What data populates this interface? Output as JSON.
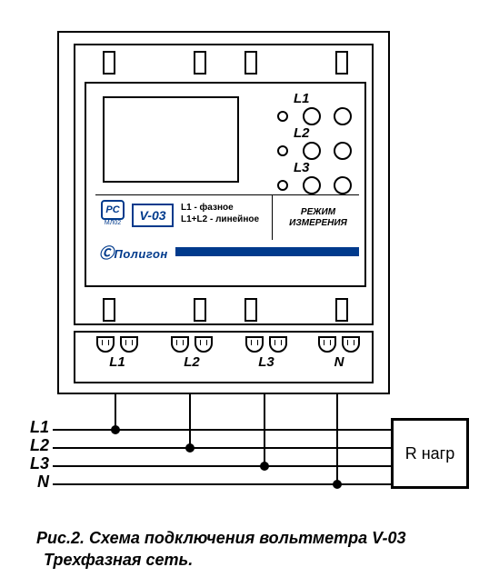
{
  "device": {
    "model": "V-03",
    "brand": "Полигон",
    "cert_mark": "PC",
    "cert_sub": "МЛ02",
    "legend_line1": "L1 - фазное",
    "legend_line2": "L1+L2 - линейное",
    "mode_line1": "РЕЖИМ",
    "mode_line2": "ИЗМЕРЕНИЯ",
    "indicators": [
      "L1",
      "L2",
      "L3"
    ],
    "terminals": [
      "L1",
      "L2",
      "L3",
      "N"
    ]
  },
  "bus_lines": [
    "L1",
    "L2",
    "L3",
    "N"
  ],
  "load_label": "R нагр",
  "caption_line1": "Рис.2. Схема подключения вольтметра V-03",
  "caption_line2": "Трехфазная сеть."
}
